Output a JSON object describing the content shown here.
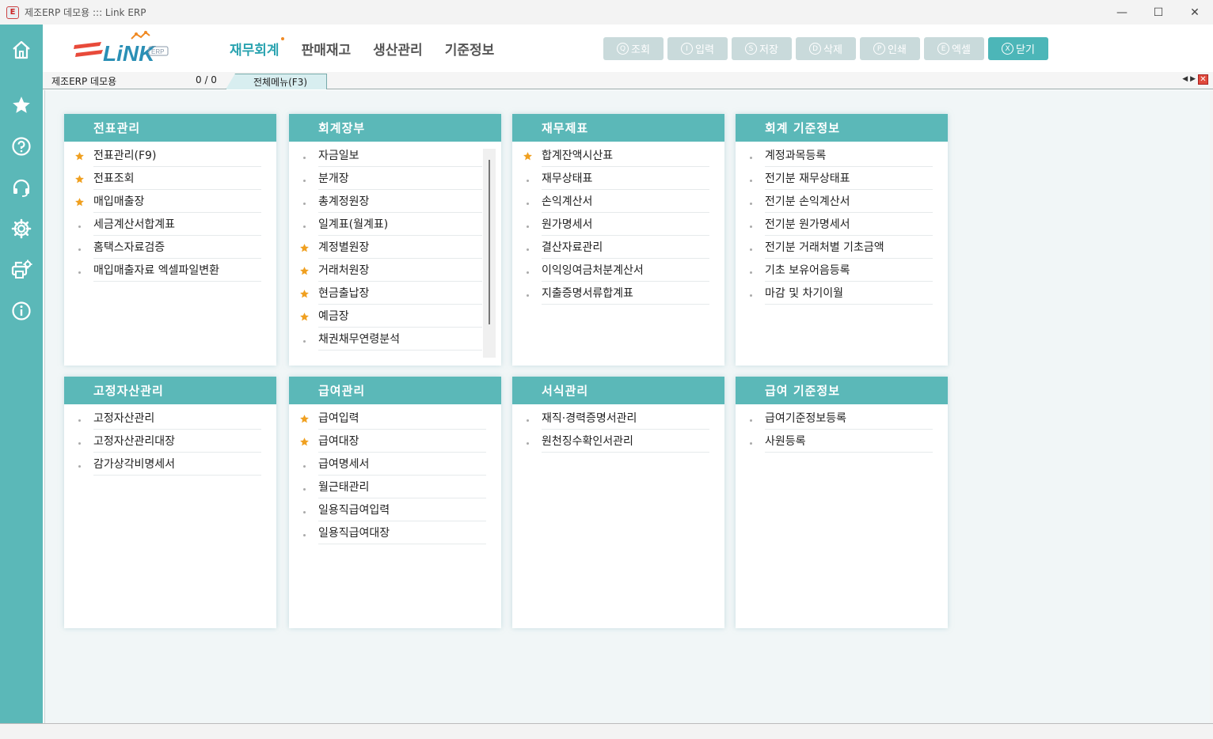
{
  "window": {
    "title": "제조ERP 데모용 ::: Link ERP",
    "minimize_label": "—",
    "maximize_label": "☐",
    "close_label": "✕"
  },
  "sidebar": {
    "items": [
      {
        "name": "home-icon"
      },
      {
        "name": "star-icon"
      },
      {
        "name": "help-icon"
      },
      {
        "name": "headset-icon"
      },
      {
        "name": "gear-icon"
      },
      {
        "name": "printer-settings-icon"
      },
      {
        "name": "info-icon"
      }
    ]
  },
  "header": {
    "logo_text": "LiNK",
    "logo_badge": "ERP",
    "nav": [
      {
        "label": "재무회계",
        "active": true
      },
      {
        "label": "판매재고",
        "active": false
      },
      {
        "label": "생산관리",
        "active": false
      },
      {
        "label": "기준정보",
        "active": false
      }
    ],
    "toolbar": [
      {
        "key": "Q",
        "label": "조회",
        "active": false
      },
      {
        "key": "I",
        "label": "입력",
        "active": false
      },
      {
        "key": "S",
        "label": "저장",
        "active": false
      },
      {
        "key": "D",
        "label": "삭제",
        "active": false
      },
      {
        "key": "P",
        "label": "인쇄",
        "active": false
      },
      {
        "key": "E",
        "label": "엑셀",
        "active": false
      },
      {
        "key": "X",
        "label": "닫기",
        "active": true
      }
    ]
  },
  "tabstrip": {
    "company": "제조ERP 데모용",
    "counter": "0 / 0",
    "tab_label": "전체메뉴(F3)",
    "arrows": "◀ ▶",
    "close_label": "✕"
  },
  "colors": {
    "accent": "#5bb8b8",
    "nav_active": "#2aa3b0",
    "star": "#f0a020",
    "toolbar_disabled": "#c9dadb"
  },
  "panels": [
    {
      "title": "전표관리",
      "items": [
        {
          "label": "전표관리(F9)",
          "fav": true
        },
        {
          "label": "전표조회",
          "fav": true
        },
        {
          "label": "매입매출장",
          "fav": true
        },
        {
          "label": "세금계산서합계표",
          "fav": false
        },
        {
          "label": "홈택스자료검증",
          "fav": false
        },
        {
          "label": "매입매출자료 엑셀파일변환",
          "fav": false
        }
      ]
    },
    {
      "title": "회계장부",
      "scroll": true,
      "items": [
        {
          "label": "자금일보",
          "fav": false
        },
        {
          "label": "분개장",
          "fav": false
        },
        {
          "label": "총계정원장",
          "fav": false
        },
        {
          "label": "일계표(월계표)",
          "fav": false
        },
        {
          "label": "계정별원장",
          "fav": true
        },
        {
          "label": "거래처원장",
          "fav": true
        },
        {
          "label": "현금출납장",
          "fav": true
        },
        {
          "label": "예금장",
          "fav": true
        },
        {
          "label": "채권채무연령분석",
          "fav": false
        }
      ]
    },
    {
      "title": "재무제표",
      "items": [
        {
          "label": "합계잔액시산표",
          "fav": true
        },
        {
          "label": "재무상태표",
          "fav": false
        },
        {
          "label": "손익계산서",
          "fav": false
        },
        {
          "label": "원가명세서",
          "fav": false
        },
        {
          "label": "결산자료관리",
          "fav": false
        },
        {
          "label": "이익잉여금처분계산서",
          "fav": false
        },
        {
          "label": "지출증명서류합계표",
          "fav": false
        }
      ]
    },
    {
      "title": "회계 기준정보",
      "items": [
        {
          "label": "계정과목등록",
          "fav": false
        },
        {
          "label": "전기분 재무상태표",
          "fav": false
        },
        {
          "label": "전기분 손익계산서",
          "fav": false
        },
        {
          "label": "전기분 원가명세서",
          "fav": false
        },
        {
          "label": "전기분 거래처별 기초금액",
          "fav": false
        },
        {
          "label": "기초 보유어음등록",
          "fav": false
        },
        {
          "label": "마감 및 차기이월",
          "fav": false
        }
      ]
    },
    {
      "title": "고정자산관리",
      "items": [
        {
          "label": "고정자산관리",
          "fav": false
        },
        {
          "label": "고정자산관리대장",
          "fav": false
        },
        {
          "label": "감가상각비명세서",
          "fav": false
        }
      ]
    },
    {
      "title": "급여관리",
      "items": [
        {
          "label": "급여입력",
          "fav": true
        },
        {
          "label": "급여대장",
          "fav": true
        },
        {
          "label": "급여명세서",
          "fav": false
        },
        {
          "label": "월근태관리",
          "fav": false
        },
        {
          "label": "일용직급여입력",
          "fav": false
        },
        {
          "label": "일용직급여대장",
          "fav": false
        }
      ]
    },
    {
      "title": "서식관리",
      "items": [
        {
          "label": "재직·경력증명서관리",
          "fav": false
        },
        {
          "label": "원천징수확인서관리",
          "fav": false
        }
      ]
    },
    {
      "title": "급여 기준정보",
      "items": [
        {
          "label": "급여기준정보등록",
          "fav": false
        },
        {
          "label": "사원등록",
          "fav": false
        }
      ]
    }
  ]
}
